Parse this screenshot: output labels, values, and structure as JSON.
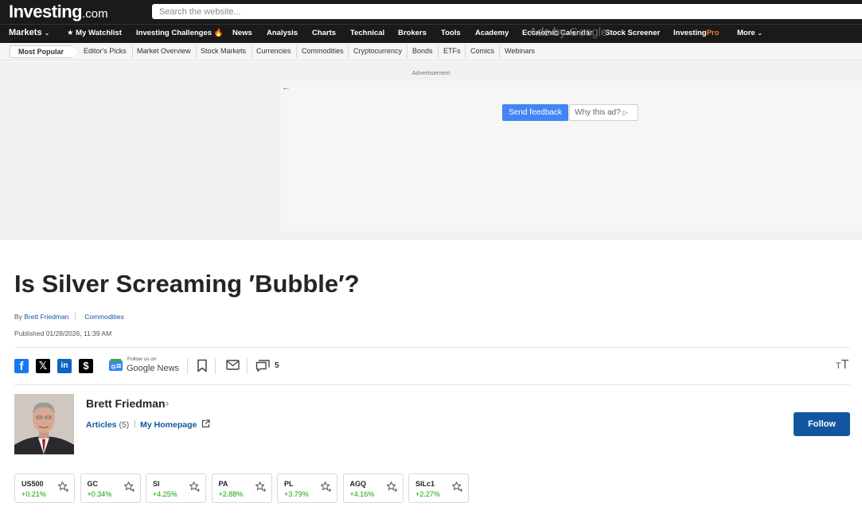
{
  "header": {
    "logo_text": "Investing",
    "logo_suffix": ".com",
    "search_placeholder": "Search the website..."
  },
  "nav": {
    "markets": "Markets",
    "watchlist": "My Watchlist",
    "challenges": "Investing Challenges",
    "news": "News",
    "analysis": "Analysis",
    "charts": "Charts",
    "technical": "Technical",
    "brokers": "Brokers",
    "tools": "Tools",
    "academy": "Academy",
    "calendar": "Economic Calendar",
    "screener": "Stock Screener",
    "pro_a": "Investing",
    "pro_b": "Pro",
    "more": "More"
  },
  "subnav": {
    "most_popular": "Most Popular",
    "items": [
      "Editor's Picks",
      "Market Overview",
      "Stock Markets",
      "Currencies",
      "Commodities",
      "Cryptocurrency",
      "Bonds",
      "ETFs",
      "Comics",
      "Webinars"
    ]
  },
  "ad": {
    "label": "Advertisement",
    "ads_by": "Ads by",
    "google": "Google",
    "send_feedback": "Send feedback",
    "why_this_ad": "Why this ad?"
  },
  "article": {
    "title": "Is Silver Screaming ′Bubble′?",
    "by": "By",
    "author": "Brett Friedman",
    "category": "Commodities",
    "published": "Published 01/28/2026, 11:39 AM"
  },
  "share": {
    "gnews_follow": "Follow us on",
    "gnews_name": "Google News",
    "comment_count": "5"
  },
  "author_box": {
    "name": "Brett Friedman",
    "articles_label": "Articles",
    "articles_count": "(5)",
    "homepage": "My Homepage",
    "follow": "Follow"
  },
  "tickers": [
    {
      "symbol": "US500",
      "change": "+0.21%"
    },
    {
      "symbol": "GC",
      "change": "+0.34%"
    },
    {
      "symbol": "SI",
      "change": "+4.25%"
    },
    {
      "symbol": "PA",
      "change": "+2.88%"
    },
    {
      "symbol": "PL",
      "change": "+3.79%"
    },
    {
      "symbol": "AGQ",
      "change": "+4.16%"
    },
    {
      "symbol": "SILc1",
      "change": "+2.27%"
    }
  ],
  "colors": {
    "header_bg": "#1a1a1a",
    "link_blue": "#1256a0",
    "positive_green": "#0ea600",
    "pro_orange": "#ff7a1a",
    "ad_button_blue": "#4285f4"
  }
}
